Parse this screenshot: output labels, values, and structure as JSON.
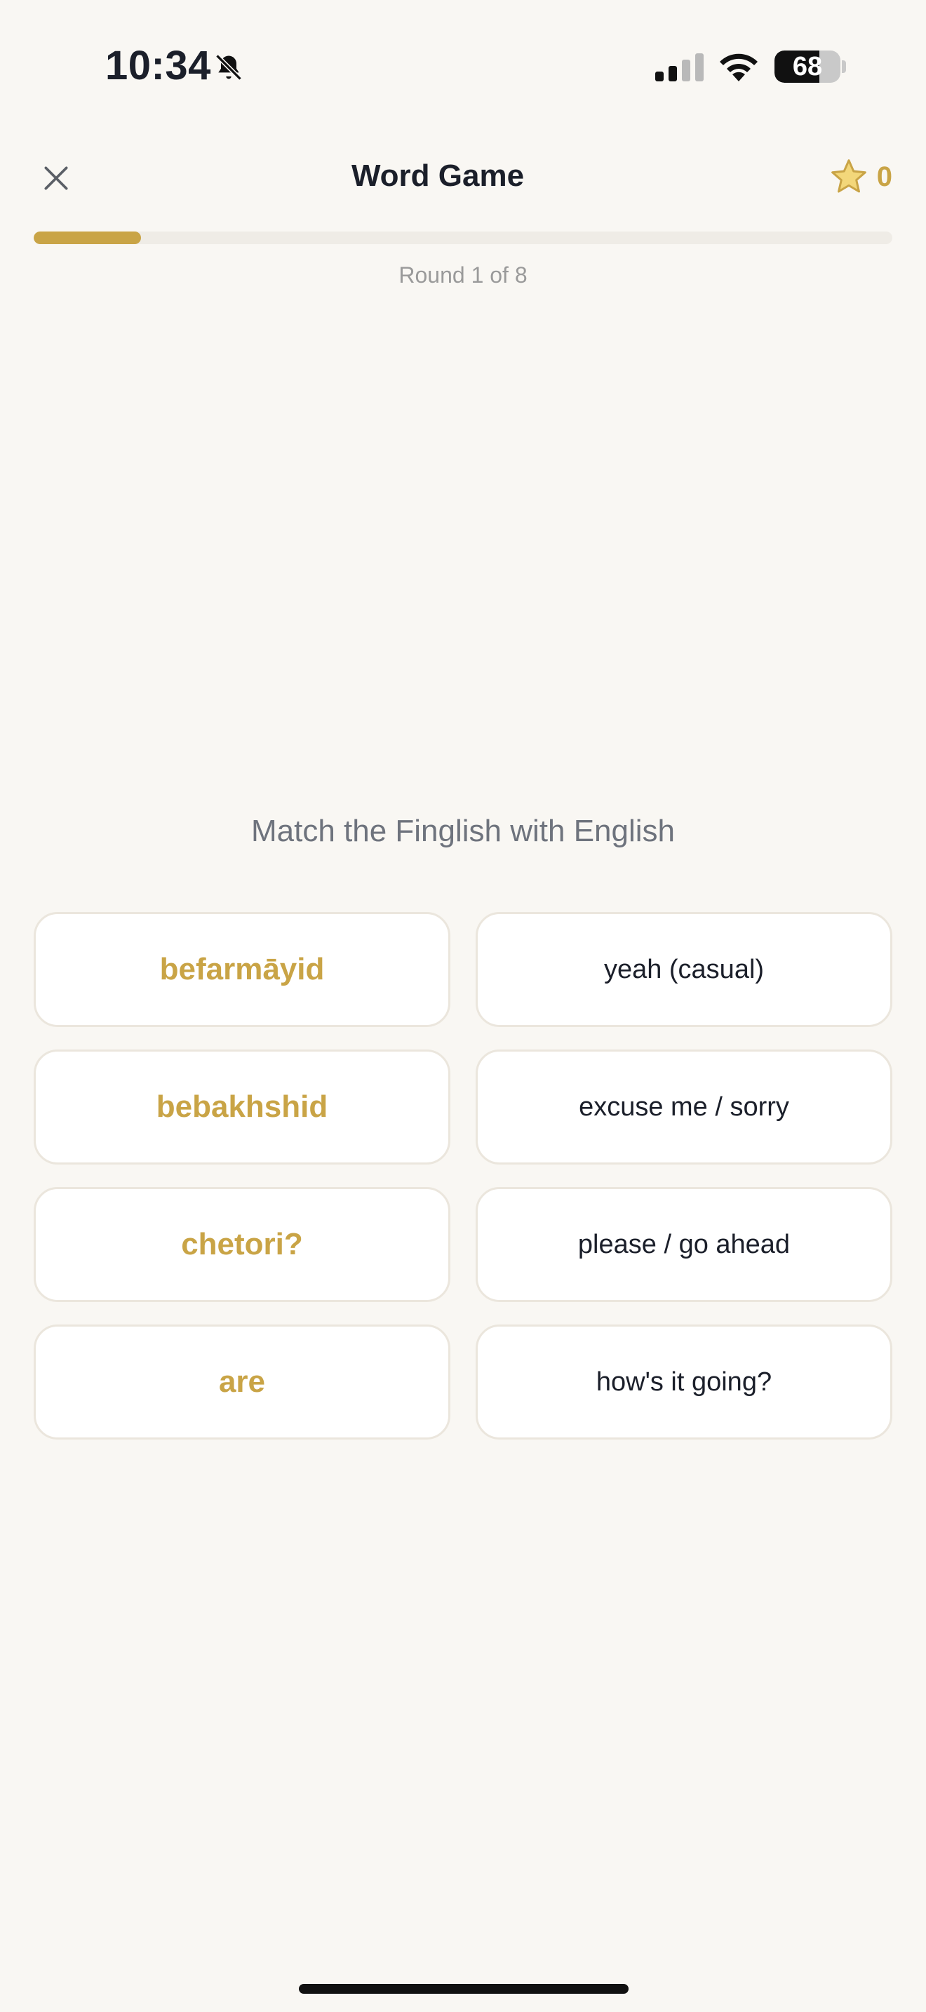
{
  "status_bar": {
    "time": "10:34",
    "battery_level": 68,
    "battery_text": "68",
    "icons": [
      "bell-off-icon",
      "signal-icon",
      "wifi-icon",
      "battery-icon"
    ]
  },
  "header": {
    "title": "Word Game",
    "close_icon": "close-icon",
    "score_icon": "star-icon",
    "score": "0"
  },
  "progress": {
    "fraction": 0.125,
    "label": "Round 1 of 8"
  },
  "game": {
    "prompt": "Match the Finglish with English",
    "finglish": [
      "befarmāyid",
      "bebakhshid",
      "chetori?",
      "are"
    ],
    "english": [
      "yeah (casual)",
      "excuse me / sorry",
      "please / go ahead",
      "how's it going?"
    ]
  },
  "colors": {
    "accent": "#c9a446",
    "background": "#f9f7f3",
    "card_border": "#ebe6dd",
    "text_primary": "#1b1f2a",
    "text_secondary": "#6e737d"
  }
}
